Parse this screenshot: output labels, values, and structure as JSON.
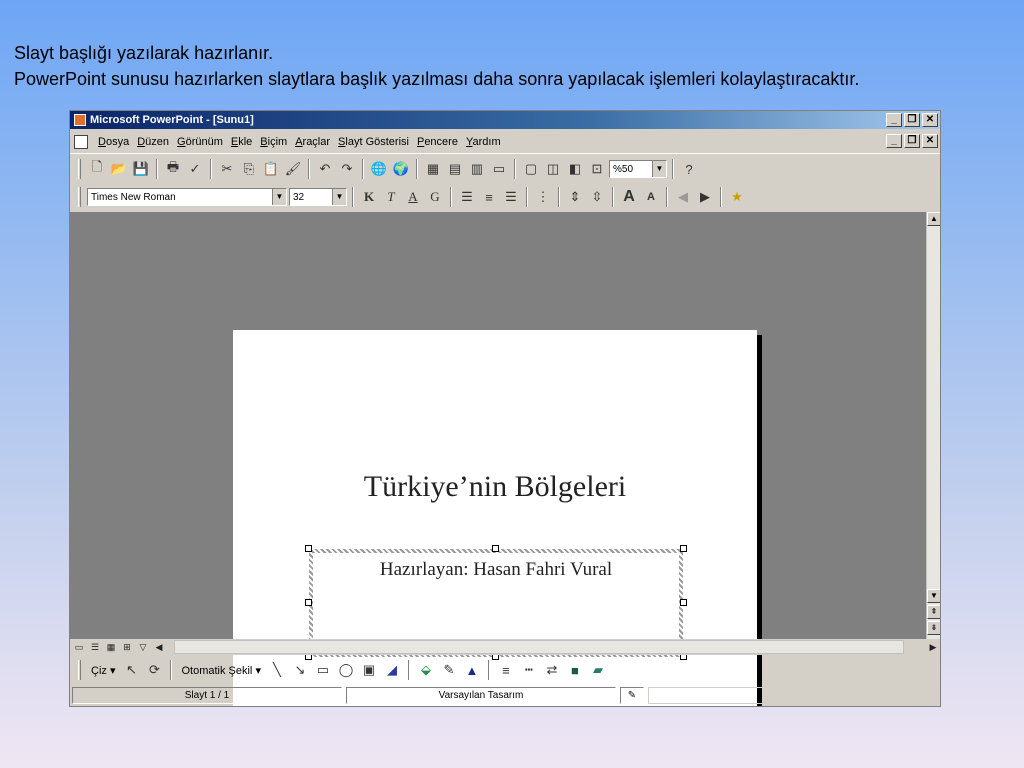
{
  "caption": {
    "line1": "Slayt başlığı yazılarak hazırlanır.",
    "line2": "PowerPoint sunusu hazırlarken slaytlara başlık yazılması daha sonra yapılacak işlemleri kolaylaştıracaktır."
  },
  "window": {
    "title": "Microsoft PowerPoint - [Sunu1]",
    "buttons": {
      "minimize": "_",
      "restore": "❐",
      "close": "✕"
    }
  },
  "menu": {
    "items": [
      "Dosya",
      "Düzen",
      "Görünüm",
      "Ekle",
      "Biçim",
      "Araçlar",
      "Slayt Gösterisi",
      "Pencere",
      "Yardım"
    ]
  },
  "toolbar_standard": {
    "zoom": "%50"
  },
  "toolbar_formatting": {
    "font_name": "Times New Roman",
    "font_size": "32",
    "bold": "K",
    "italic": "T",
    "underline": "A",
    "shadow": "G",
    "increase_font": "A",
    "decrease_font": "A"
  },
  "slide": {
    "title": "Türkiye’nin Bölgeleri",
    "subtitle": "Hazırlayan: Hasan Fahri Vural"
  },
  "drawing_toolbar": {
    "draw_menu": "Çiz",
    "autoshapes": "Otomatik Şekil"
  },
  "status": {
    "slide_counter": "Slayt 1 / 1",
    "design": "Varsayılan Tasarım"
  }
}
